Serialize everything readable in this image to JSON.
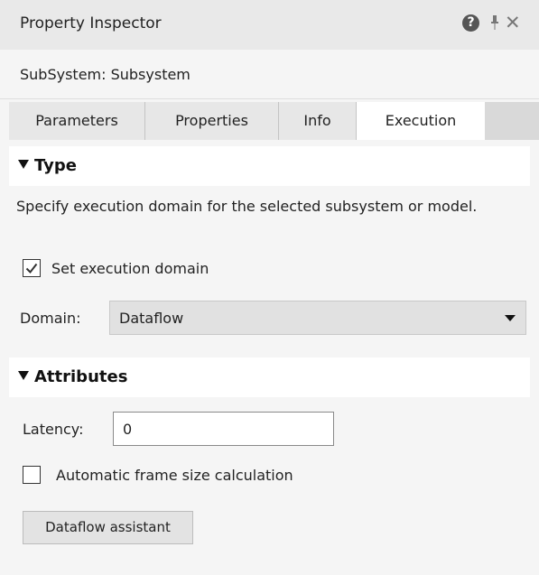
{
  "window": {
    "title": "Property Inspector",
    "icons": [
      "help-icon",
      "pin-icon",
      "close-icon"
    ],
    "close_glyph": "✕"
  },
  "block_path": "SubSystem: Subsystem",
  "tabs": [
    {
      "label": "Parameters",
      "active": false
    },
    {
      "label": "Properties",
      "active": false
    },
    {
      "label": "Info",
      "active": false
    },
    {
      "label": "Execution",
      "active": true
    }
  ],
  "type_section": {
    "header": "Type",
    "description": "Specify execution domain for the selected subsystem or model.",
    "set_domain": {
      "label": "Set execution domain",
      "checked": true
    },
    "domain": {
      "label": "Domain:",
      "value": "Dataflow"
    }
  },
  "attributes_section": {
    "header": "Attributes",
    "latency": {
      "label": "Latency:",
      "value": "0"
    },
    "auto_frame": {
      "label": "Automatic frame size calculation",
      "checked": false
    },
    "assistant_button": "Dataflow assistant"
  },
  "colors": {
    "titlebar_bg": "#e9e9e9",
    "tab_active_bg": "#ffffff",
    "dropdown_bg": "#e1e1e1"
  }
}
